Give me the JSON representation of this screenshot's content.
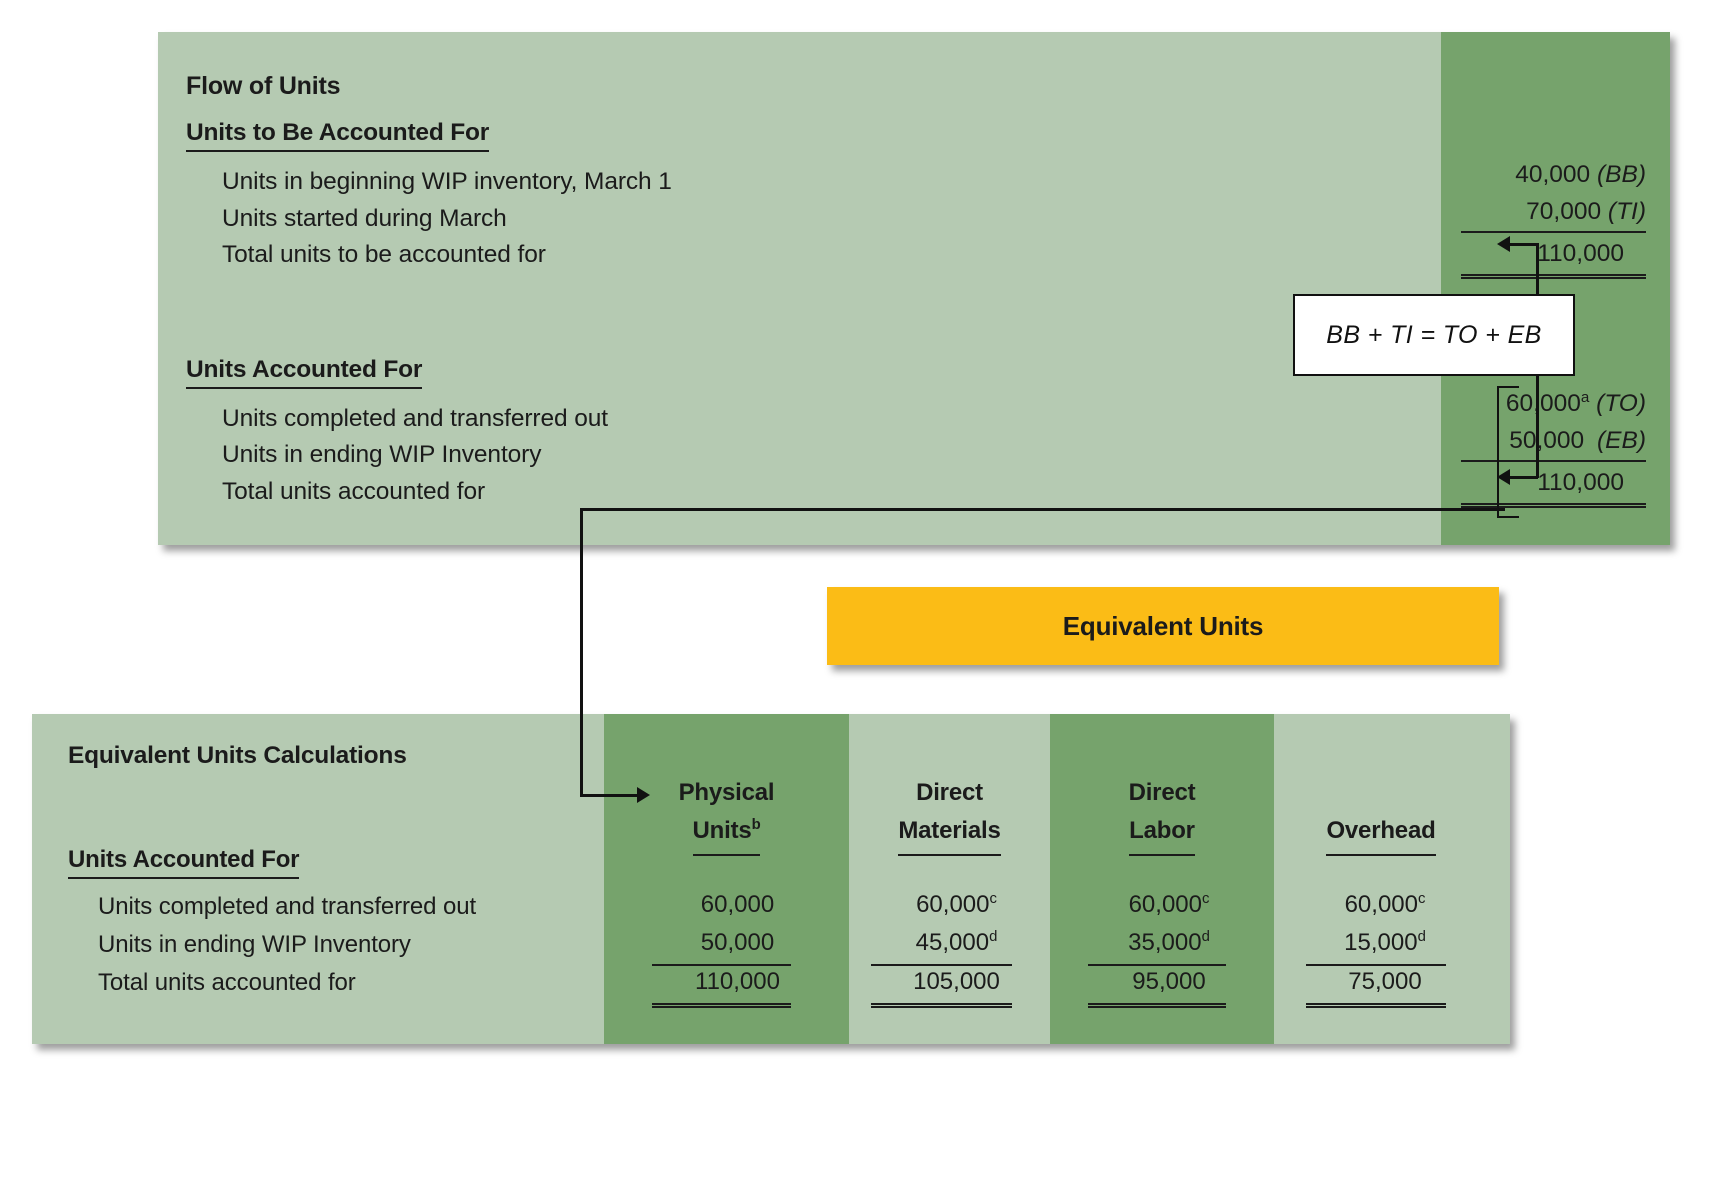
{
  "top_panel": {
    "title": "Flow of Units",
    "section1_heading": "Units to Be Accounted For",
    "section1_rows": [
      {
        "label": "Units in beginning WIP inventory, March 1",
        "amount": "40,000",
        "tag": "(BB)",
        "sup": ""
      },
      {
        "label": "Units started during March",
        "amount": "70,000",
        "tag": "(TI)",
        "sup": ""
      },
      {
        "label": "Total units to be accounted for",
        "amount": "110,000",
        "tag": "",
        "sup": ""
      }
    ],
    "section2_heading": "Units Accounted For",
    "section2_rows": [
      {
        "label": "Units completed and transferred out",
        "amount": "60,000",
        "tag": "(TO)",
        "sup": "a"
      },
      {
        "label": "Units in ending WIP Inventory",
        "amount": "50,000",
        "tag": "(EB)",
        "sup": ""
      },
      {
        "label": "Total units accounted for",
        "amount": "110,000",
        "tag": "",
        "sup": ""
      }
    ]
  },
  "formula": {
    "text": "BB + TI = TO  + EB"
  },
  "banner": {
    "label": "Equivalent Units"
  },
  "bottom_panel": {
    "title": "Equivalent Units Calculations",
    "section_heading": "Units Accounted For",
    "row_labels": [
      "Units completed and transferred out",
      "Units in ending WIP Inventory",
      "Total units accounted for"
    ],
    "columns": [
      {
        "head_line1": "Physical",
        "head_line2": "Units",
        "head_sup": "b"
      },
      {
        "head_line1": "Direct",
        "head_line2": "Materials",
        "head_sup": ""
      },
      {
        "head_line1": "Direct",
        "head_line2": "Labor",
        "head_sup": ""
      },
      {
        "head_line1": "",
        "head_line2": "Overhead",
        "head_sup": ""
      }
    ],
    "cells": [
      [
        {
          "v": "60,000",
          "s": ""
        },
        {
          "v": "60,000",
          "s": "c"
        },
        {
          "v": "60,000",
          "s": "c"
        },
        {
          "v": "60,000",
          "s": "c"
        }
      ],
      [
        {
          "v": "50,000",
          "s": ""
        },
        {
          "v": "45,000",
          "s": "d"
        },
        {
          "v": "35,000",
          "s": "d"
        },
        {
          "v": "15,000",
          "s": "d"
        }
      ],
      [
        {
          "v": "110,000",
          "s": ""
        },
        {
          "v": "105,000",
          "s": ""
        },
        {
          "v": "95,000",
          "s": ""
        },
        {
          "v": "75,000",
          "s": ""
        }
      ]
    ]
  },
  "chart_data": {
    "type": "table",
    "title": "Flow of Units and Equivalent Units Calculations",
    "colors": {
      "panel_light_green": "#b5cab2",
      "panel_dark_green": "#76a36c",
      "banner_yellow": "#fbbc16",
      "text": "#1b1b1b",
      "line": "#111111"
    },
    "flow_of_units": {
      "units_to_be_accounted_for": {
        "beginning_wip_march_1": 40000,
        "started_during_march": 70000,
        "total": 110000
      },
      "units_accounted_for": {
        "completed_and_transferred_out": 60000,
        "ending_wip_inventory": 50000,
        "total": 110000
      },
      "identity": "BB + TI = TO + EB"
    },
    "equivalent_units": {
      "categories": [
        "Physical Units",
        "Direct Materials",
        "Direct Labor",
        "Overhead"
      ],
      "series": [
        {
          "name": "Units completed and transferred out",
          "values": [
            60000,
            60000,
            60000,
            60000
          ]
        },
        {
          "name": "Units in ending WIP Inventory",
          "values": [
            50000,
            45000,
            35000,
            15000
          ]
        },
        {
          "name": "Total units accounted for",
          "values": [
            110000,
            105000,
            95000,
            75000
          ]
        }
      ]
    }
  }
}
